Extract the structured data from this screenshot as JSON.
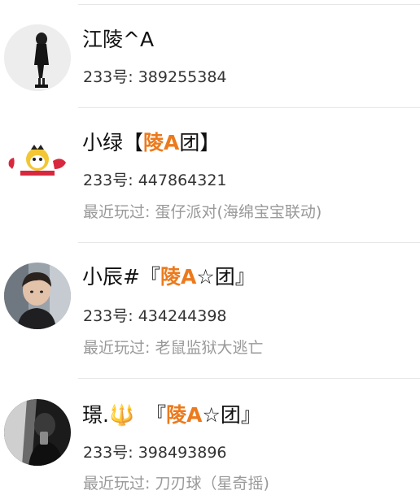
{
  "contacts": [
    {
      "name": "江陵^A",
      "id_label": "233号: ",
      "id_value": "389255384",
      "avatar": "avatar-figure-standing"
    },
    {
      "name_prefix": "小绿【",
      "name_accent": "陵A",
      "name_suffix": "团】",
      "id_label": "233号: ",
      "id_value": "447864321",
      "recent_label": "最近玩过: ",
      "recent_game": "蛋仔派对(海绵宝宝联动)",
      "avatar": "avatar-panda-sticker"
    },
    {
      "name_prefix": "小辰#『",
      "name_accent": "陵A",
      "name_suffix": "☆团』",
      "id_label": "233号: ",
      "id_value": "434244398",
      "recent_label": "最近玩过: ",
      "recent_game": "老鼠监狱大逃亡",
      "avatar": "avatar-photo-person"
    },
    {
      "name_prefix": "璟.",
      "name_symbol": "🔱",
      "name_mid": "『",
      "name_accent": "陵A",
      "name_suffix": "☆团』",
      "id_label": "233号: ",
      "id_value": "398493896",
      "recent_label": "最近玩过: ",
      "recent_game": "刀刃球（星奇摇)",
      "avatar": "avatar-dark-photo"
    }
  ]
}
